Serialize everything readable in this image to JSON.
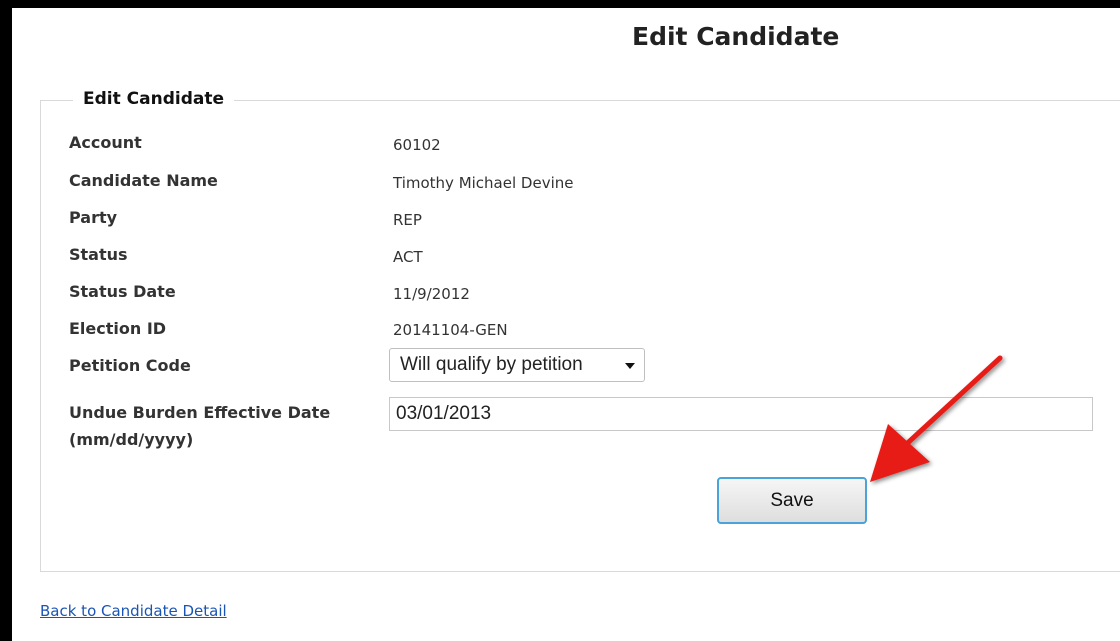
{
  "header": {
    "title": "Edit Candidate"
  },
  "form": {
    "legend": "Edit Candidate",
    "rows": [
      {
        "label": "Account",
        "value": "60102"
      },
      {
        "label": "Candidate Name",
        "value": "Timothy Michael Devine"
      },
      {
        "label": "Party",
        "value": "REP"
      },
      {
        "label": "Status",
        "value": "ACT"
      },
      {
        "label": "Status Date",
        "value": "11/9/2012"
      },
      {
        "label": "Election ID",
        "value": "20141104-GEN"
      }
    ],
    "petition_code": {
      "label": "Petition Code",
      "selected": "Will qualify by petition"
    },
    "undue_burden": {
      "label_line1": "Undue Burden Effective Date",
      "label_line2": "(mm/dd/yyyy)",
      "value": "03/01/2013"
    },
    "save_label": "Save"
  },
  "footer": {
    "back_link": "Back to Candidate Detail"
  },
  "colors": {
    "arrow": "#e81a14",
    "link": "#1a55b5",
    "button_border": "#4aa3d9"
  },
  "icons": {
    "dropdown": "chevron-down-icon",
    "annotation": "red-arrow-annotation"
  }
}
